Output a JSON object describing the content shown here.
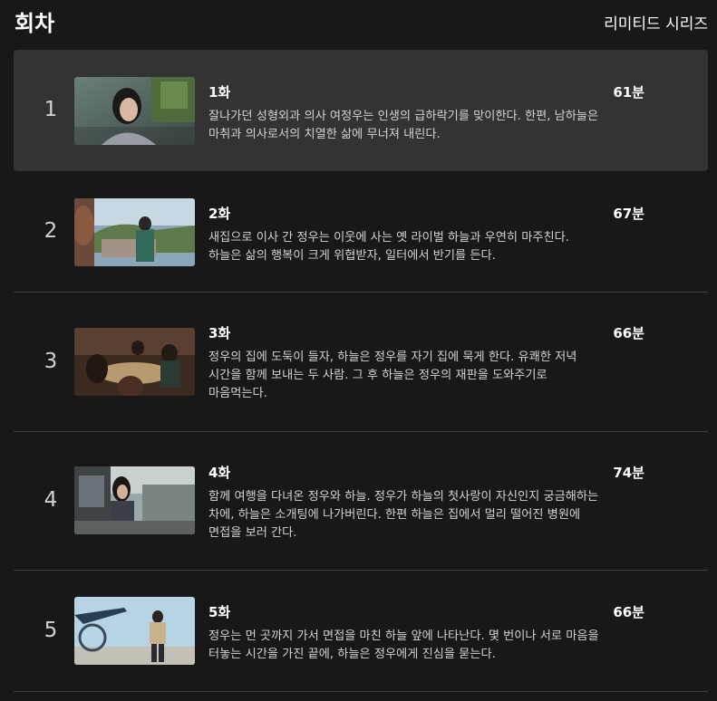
{
  "header": {
    "title": "회차",
    "series_type": "리미티드 시리즈"
  },
  "episodes": [
    {
      "number": "1",
      "title": "1화",
      "duration": "61분",
      "description": "잘나가던 성형외과 의사 여정우는 인생의 급하락기를 맞이한다. 한편, 남하늘은\n마취과 의사로서의 치열한 삶에 무너져 내린다.",
      "thumbnail": "episode-1-still"
    },
    {
      "number": "2",
      "title": "2화",
      "duration": "67분",
      "description": "새집으로 이사 간 정우는 이웃에 사는 옛 라이벌 하늘과 우연히 마주친다.\n하늘은 삶의 행복이 크게 위협받자, 일터에서 반기를 든다.",
      "thumbnail": "episode-2-still"
    },
    {
      "number": "3",
      "title": "3화",
      "duration": "66분",
      "description": "정우의 집에 도둑이 들자, 하늘은 정우를 자기 집에 묵게 한다. 유쾌한 저녁\n시간을 함께 보내는 두 사람. 그 후 하늘은 정우의 재판을 도와주기로\n마음먹는다.",
      "thumbnail": "episode-3-still"
    },
    {
      "number": "4",
      "title": "4화",
      "duration": "74분",
      "description": "함께 여행을 다녀온 정우와 하늘. 정우가 하늘의 첫사랑이 자신인지 궁금해하는\n차에, 하늘은 소개팅에 나가버린다. 한편 하늘은 집에서 멀리 떨어진 병원에\n면접을 보러 간다.",
      "thumbnail": "episode-4-still"
    },
    {
      "number": "5",
      "title": "5화",
      "duration": "66분",
      "description": "정우는 먼 곳까지 가서 면접을 마친 하늘 앞에 나타난다. 몇 번이나 서로 마음을\n터놓는 시간을 가진 끝에, 하늘은 정우에게 진심을 묻는다.",
      "thumbnail": "episode-5-still"
    }
  ],
  "colors": {
    "background": "#181818",
    "selected_row": "#333333",
    "divider": "#404040",
    "text_primary": "#ffffff",
    "text_secondary": "#d2d2d2"
  }
}
